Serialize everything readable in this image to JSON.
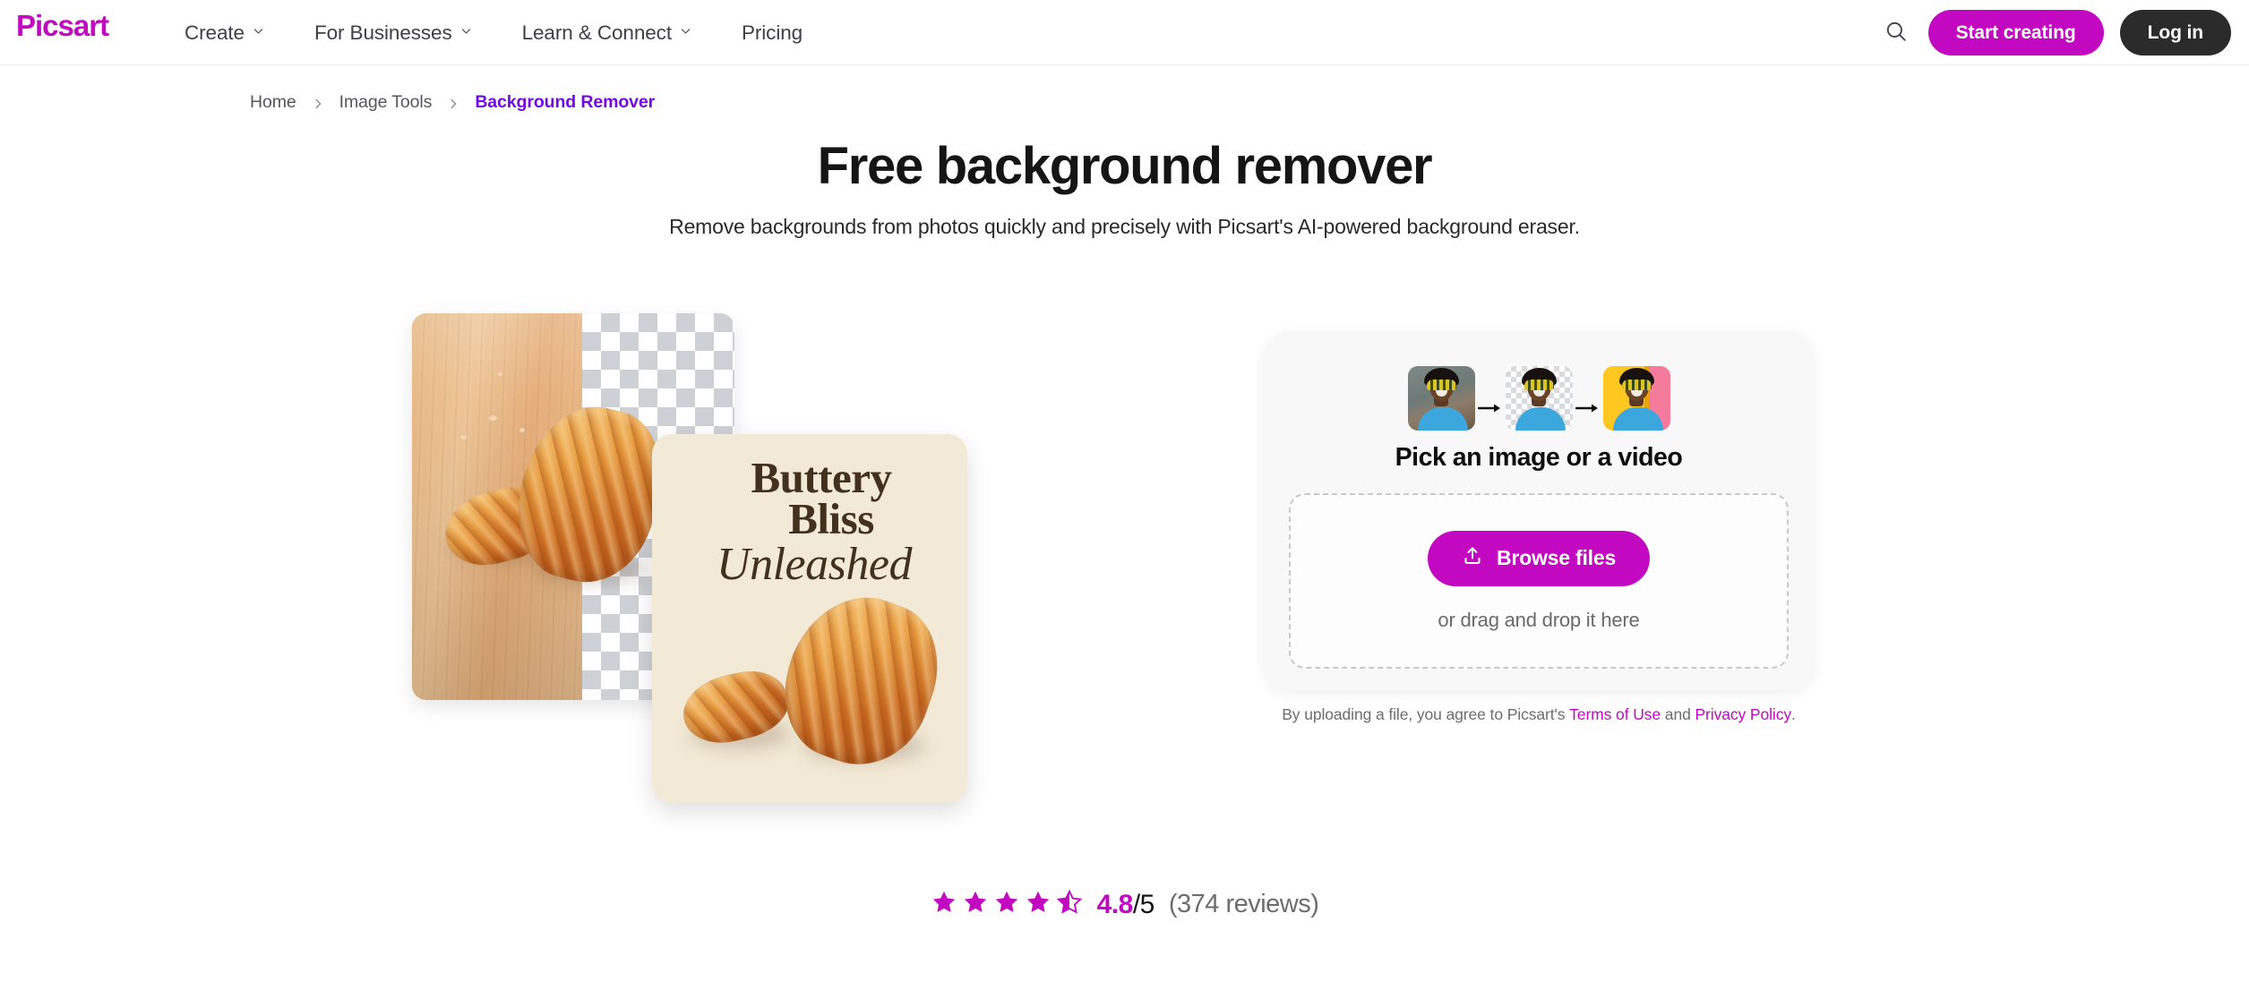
{
  "brand": {
    "name": "Picsart",
    "accent": "#C209C1",
    "dark": "#2B2B2B",
    "breadcrumb_active": "#7209E4"
  },
  "header": {
    "logo_text": "Picsart",
    "nav": [
      {
        "label": "Create",
        "has_dropdown": true,
        "icon": "chevron-down-icon"
      },
      {
        "label": "For Businesses",
        "has_dropdown": true,
        "icon": "chevron-down-icon"
      },
      {
        "label": "Learn & Connect",
        "has_dropdown": true,
        "icon": "chevron-down-icon"
      },
      {
        "label": "Pricing",
        "has_dropdown": false,
        "icon": ""
      }
    ],
    "search_icon": "search-icon",
    "start_creating_label": "Start creating",
    "login_label": "Log in"
  },
  "breadcrumb": {
    "items": [
      {
        "label": "Home",
        "current": false
      },
      {
        "label": "Image Tools",
        "current": false
      },
      {
        "label": "Background Remover",
        "current": true
      }
    ],
    "separator_icon": "chevron-right-icon"
  },
  "hero": {
    "title": "Free background remover",
    "subtitle": "Remove backgrounds from photos quickly and precisely with Picsart's AI-powered background eraser.",
    "poster": {
      "line1": "Buttery",
      "line2": "Bliss",
      "line3": "Unleashed",
      "bg_color": "#F2EAD6",
      "text_color": "#43301D"
    },
    "preview_alt": "croissants on wooden board with transparent checkerboard background"
  },
  "upload": {
    "thumbnails": [
      {
        "name": "original-photo-thumbnail",
        "state": "original"
      },
      {
        "name": "transparent-photo-thumbnail",
        "state": "background-removed"
      },
      {
        "name": "new-background-thumbnail",
        "state": "new-background"
      }
    ],
    "arrow_icon": "arrow-right-icon",
    "title": "Pick an image or a video",
    "browse_label": "Browse files",
    "browse_icon": "upload-icon",
    "drag_text": "or drag and drop it here",
    "legal": {
      "prefix": "By uploading a file, you agree to Picsart's ",
      "terms_label": "Terms of Use",
      "middle": " and ",
      "privacy_label": "Privacy Policy",
      "suffix": "."
    }
  },
  "rating": {
    "score": "4.8",
    "out_of": "/5",
    "reviews": "(374 reviews)",
    "stars_total": 5,
    "stars_filled": 4,
    "stars_half": 1,
    "star_color": "#C209C1"
  }
}
